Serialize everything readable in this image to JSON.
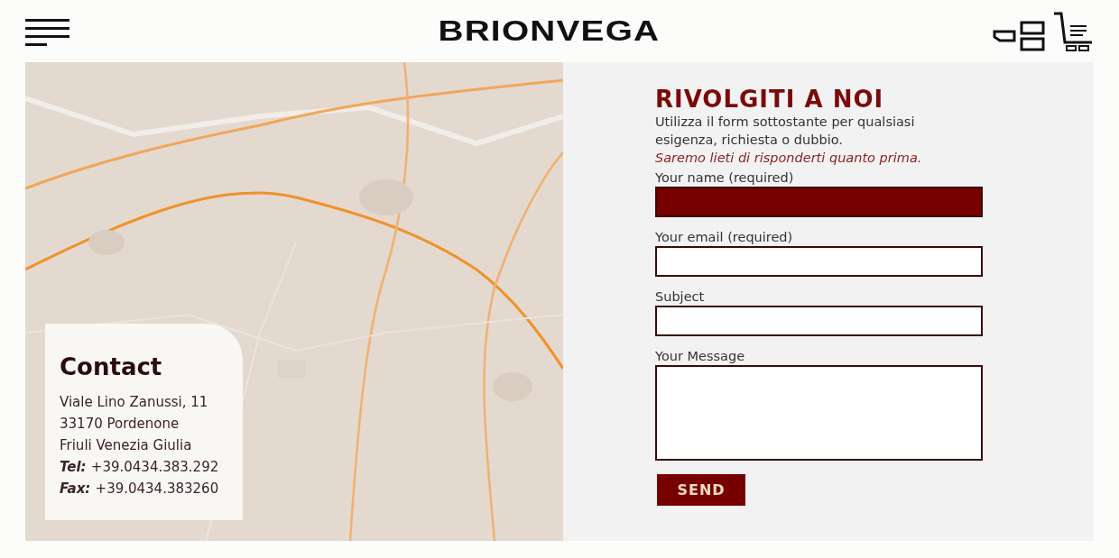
{
  "header": {
    "logo": "BRIONVEGA"
  },
  "contact": {
    "title": "Contact",
    "lines": [
      {
        "text": "Viale Lino Zanussi, 11"
      },
      {
        "text": "33170 Pordenone"
      },
      {
        "text": "Friuli Venezia Giulia"
      },
      {
        "label": "Tel:",
        "text": "+39.0434.383.292"
      },
      {
        "label": "Fax:",
        "text": "+39.0434.383260"
      }
    ]
  },
  "form": {
    "title": "RIVOLGITI A NOI",
    "intro": "Utilizza il form sottostante per qualsiasi esigenza, richiesta o dubbio.",
    "note": "Saremo lieti di risponderti quanto prima.",
    "fields": [
      {
        "label": "Your name (required)",
        "kind": "input",
        "focused": true
      },
      {
        "label": "Your email (required)",
        "kind": "input",
        "focused": false
      },
      {
        "label": "Subject",
        "kind": "input",
        "focused": false
      },
      {
        "label": "Your Message",
        "kind": "textarea",
        "focused": false
      }
    ],
    "submit": "SEND"
  }
}
